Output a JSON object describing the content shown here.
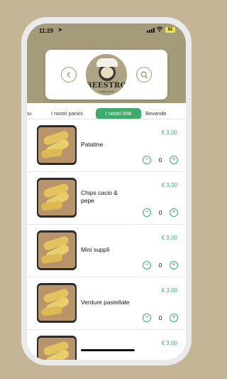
{
  "status_bar": {
    "time": "11:29",
    "battery": "92"
  },
  "header": {
    "brand": "BEESTROT",
    "tagline": "STREET FOOD"
  },
  "tabs": [
    {
      "label": "nu"
    },
    {
      "label": "I nostri panini"
    },
    {
      "label": "I nostri fritti",
      "active": true
    },
    {
      "label": "Bevande"
    }
  ],
  "items": [
    {
      "name": "Patatine",
      "price": "€ 3,00",
      "qty": "0"
    },
    {
      "name": "Chips cacio & pepe",
      "price": "€ 3,00",
      "qty": "0"
    },
    {
      "name": "Mini supplì",
      "price": "€ 3,00",
      "qty": "0"
    },
    {
      "name": "Verdure pastellate",
      "price": "€ 3,00",
      "qty": "0"
    },
    {
      "name": "",
      "price": "€ 3,00",
      "qty": ""
    }
  ],
  "colors": {
    "accent": "#3dab6c",
    "header": "#a39b79",
    "background": "#c3b595"
  },
  "icons": {
    "back": "chevron-left-icon",
    "search": "search-icon",
    "minus": "minus-icon",
    "plus": "plus-icon"
  }
}
